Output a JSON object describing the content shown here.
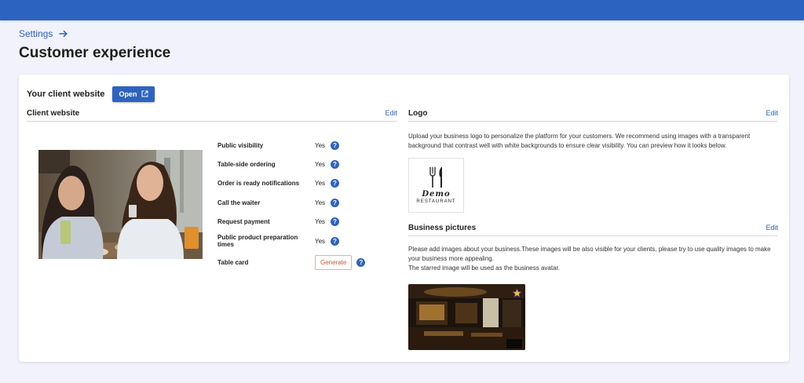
{
  "breadcrumb": {
    "label": "Settings"
  },
  "page": {
    "title": "Customer experience"
  },
  "client_site": {
    "label": "Your client website",
    "open_label": "Open"
  },
  "client_website": {
    "title": "Client website",
    "edit_label": "Edit",
    "settings": [
      {
        "label": "Public visibility",
        "value": "Yes"
      },
      {
        "label": "Table-side ordering",
        "value": "Yes"
      },
      {
        "label": "Order is ready notifications",
        "value": "Yes"
      },
      {
        "label": "Call the waiter",
        "value": "Yes"
      },
      {
        "label": "Request payment",
        "value": "Yes"
      },
      {
        "label": "Public product preparation times",
        "value": "Yes"
      },
      {
        "label": "Table card",
        "button": "Generate"
      }
    ]
  },
  "logo": {
    "title": "Logo",
    "edit_label": "Edit",
    "description": "Upload your business logo to personalize the platform for your customers. We recommend using images with a transparent background that contrast well with white backgrounds to ensure clear visibility. You can preview how it looks below.",
    "logo_text": "Demo",
    "logo_subtext": "RESTAURANT"
  },
  "business_pictures": {
    "title": "Business pictures",
    "edit_label": "Edit",
    "description_1": "Please add images about your business.These images will be also visible for your clients, please try to use quality images to make your business more appealing.",
    "description_2": "The starred image will be used as the business avatar."
  },
  "help_glyph": "?",
  "colors": {
    "topbar": "#2d63c0",
    "accent": "#2d63c0",
    "background": "#f1f2fb",
    "generate": "#c65a3a",
    "star": "#f2c230"
  }
}
